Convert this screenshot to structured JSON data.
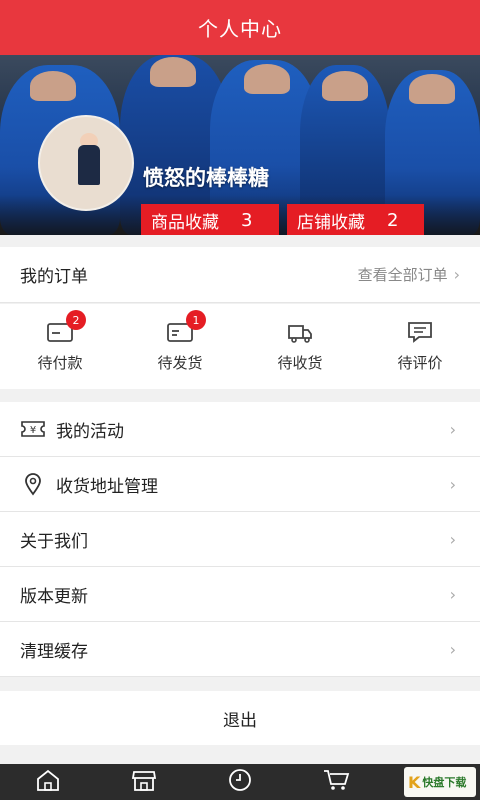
{
  "header": {
    "title": "个人中心"
  },
  "profile": {
    "username": "愤怒的棒棒糖",
    "stats": [
      {
        "label": "商品收藏",
        "count": "3"
      },
      {
        "label": "店铺收藏",
        "count": "2"
      }
    ]
  },
  "orders": {
    "title": "我的订单",
    "view_all": "查看全部订单",
    "items": [
      {
        "label": "待付款",
        "icon": "wallet-icon",
        "badge": "2"
      },
      {
        "label": "待发货",
        "icon": "box-icon",
        "badge": "1"
      },
      {
        "label": "待收货",
        "icon": "truck-icon"
      },
      {
        "label": "待评价",
        "icon": "comment-icon"
      }
    ]
  },
  "menu": {
    "items": [
      {
        "label": "我的活动",
        "icon": "ticket-icon"
      },
      {
        "label": "收货地址管理",
        "icon": "location-pin-icon"
      },
      {
        "label": "关于我们"
      },
      {
        "label": "版本更新"
      },
      {
        "label": "清理缓存"
      }
    ]
  },
  "logout_label": "退出",
  "tabbar": {
    "items": [
      {
        "icon": "home-icon"
      },
      {
        "icon": "store-icon"
      },
      {
        "icon": "clock-icon"
      },
      {
        "icon": "cart-icon"
      }
    ]
  },
  "watermark": {
    "text": "快盘下载",
    "icon": "logo-icon"
  },
  "colors": {
    "accent": "#e8373e",
    "badge": "#e51d24",
    "tabbar": "#2c2c2c"
  }
}
